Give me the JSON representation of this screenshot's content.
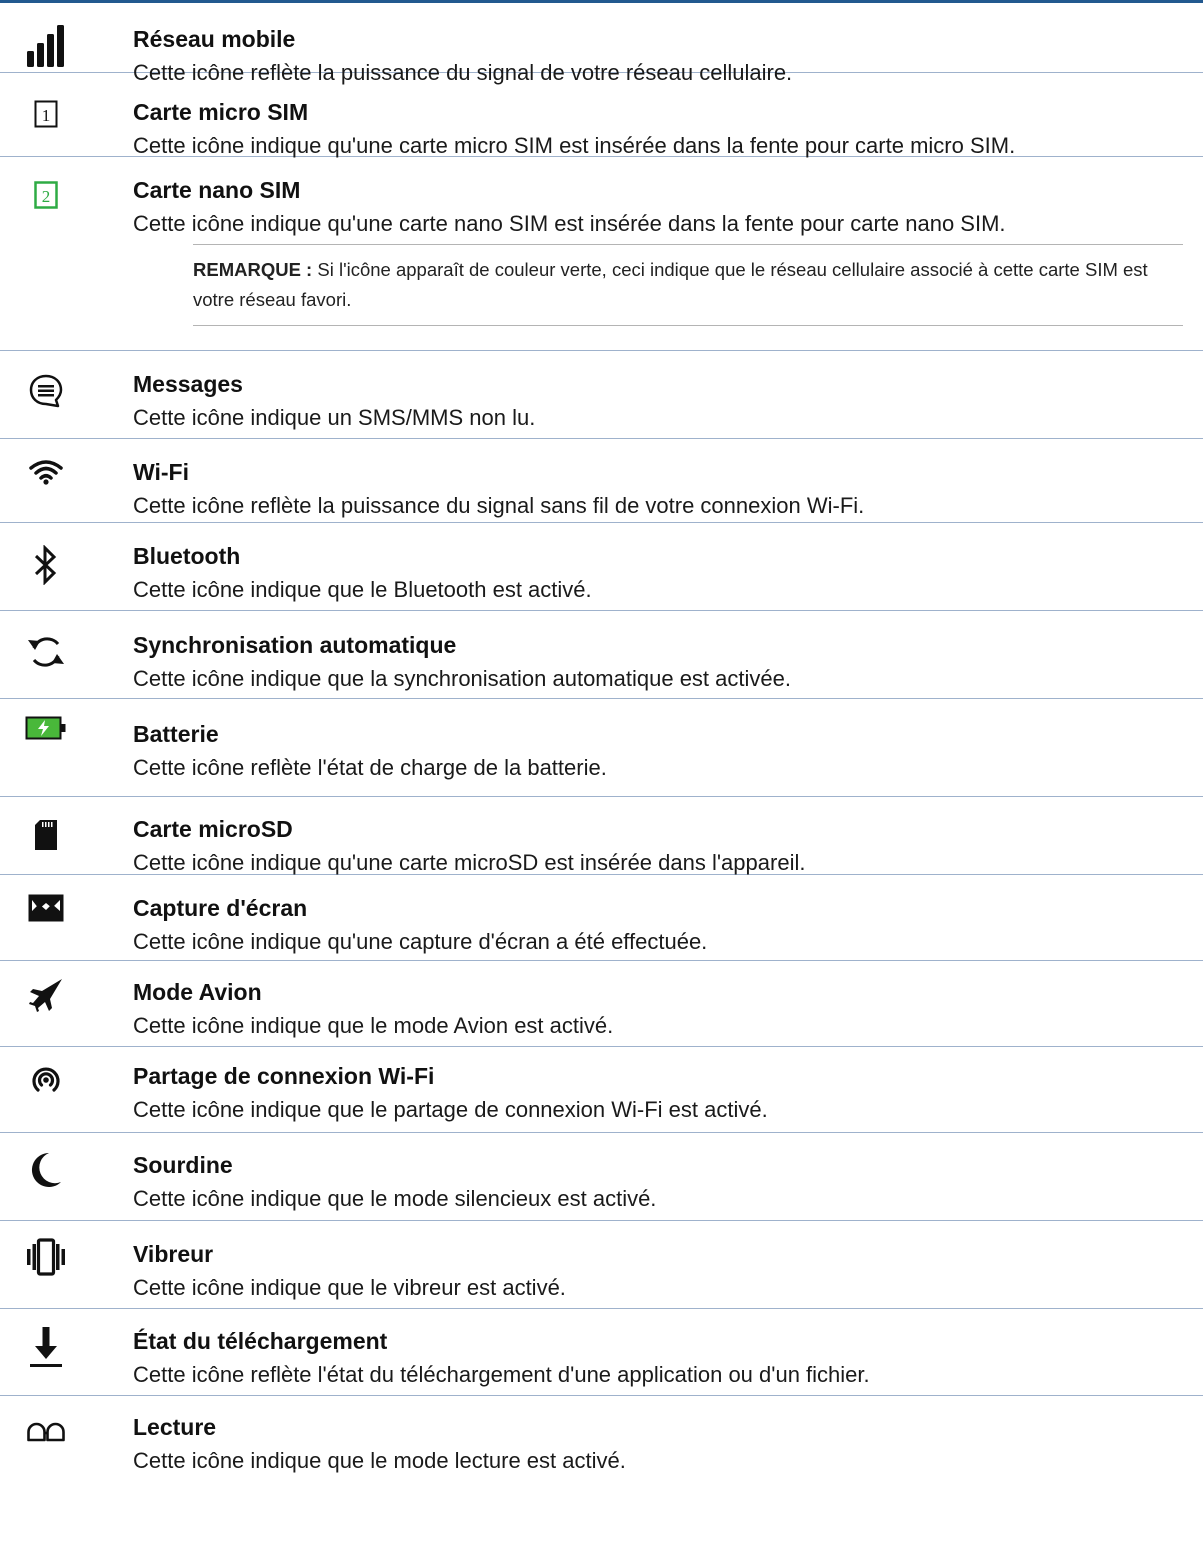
{
  "items": [
    {
      "icon": "signal-bars-icon",
      "title": "Réseau mobile",
      "desc": "Cette icône reflète la puissance du signal de votre réseau cellulaire."
    },
    {
      "icon": "sim-1-icon",
      "title": "Carte micro SIM",
      "desc": "Cette icône indique qu'une carte micro SIM est insérée dans la fente pour carte micro SIM."
    },
    {
      "icon": "sim-2-icon",
      "title": "Carte nano SIM",
      "desc": "Cette icône indique qu'une carte nano SIM est insérée dans la fente pour carte nano SIM."
    },
    {
      "icon": "message-icon",
      "title": "Messages",
      "desc": "Cette icône indique un SMS/MMS non lu."
    },
    {
      "icon": "wifi-icon",
      "title": "Wi-Fi",
      "desc": "Cette icône reflète la puissance du signal sans fil de votre connexion Wi-Fi."
    },
    {
      "icon": "bluetooth-icon",
      "title": "Bluetooth",
      "desc": "Cette icône indique que le Bluetooth est activé."
    },
    {
      "icon": "sync-icon",
      "title": "Synchronisation automatique",
      "desc": "Cette icône indique que la synchronisation automatique est activée."
    },
    {
      "icon": "battery-icon",
      "title": "Batterie",
      "desc": "Cette icône reflète l'état de charge de la batterie."
    },
    {
      "icon": "sd-card-icon",
      "title": "Carte microSD",
      "desc": "Cette icône indique qu'une carte microSD est insérée dans l'appareil."
    },
    {
      "icon": "screenshot-icon",
      "title": "Capture d'écran",
      "desc": "Cette icône indique qu'une capture d'écran a été effectuée."
    },
    {
      "icon": "airplane-icon",
      "title": "Mode Avion",
      "desc": "Cette icône indique que le mode Avion est activé."
    },
    {
      "icon": "hotspot-icon",
      "title": "Partage de connexion Wi-Fi",
      "desc": "Cette icône indique que le partage de connexion Wi-Fi est activé."
    },
    {
      "icon": "moon-icon",
      "title": "Sourdine",
      "desc": "Cette icône indique que le mode silencieux est activé."
    },
    {
      "icon": "vibrate-icon",
      "title": "Vibreur",
      "desc": "Cette icône indique que le vibreur est activé."
    },
    {
      "icon": "download-icon",
      "title": "État du téléchargement",
      "desc": "Cette icône reflète l'état du téléchargement d'une application ou d'un fichier."
    },
    {
      "icon": "reading-glasses-icon",
      "title": "Lecture",
      "desc": "Cette icône indique que le mode lecture est activé."
    }
  ],
  "note": {
    "label": "REMARQUE :",
    "text": "Si l'icône apparaît de couleur verte, ceci indique que le réseau cellulaire associé à cette carte SIM est votre réseau favori."
  },
  "colors": {
    "accent_line": "#22598f",
    "divider": "#9fb2cc",
    "sim2_green": "#2eab44",
    "battery_green": "#49b83a"
  }
}
